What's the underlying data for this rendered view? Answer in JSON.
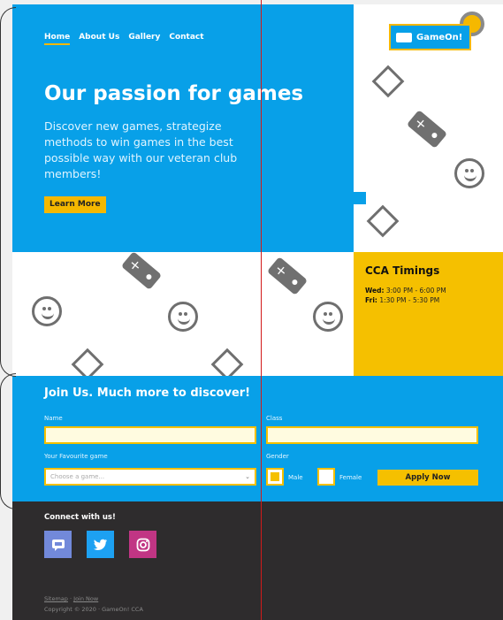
{
  "nav": {
    "items": [
      "Home",
      "About Us",
      "Gallery",
      "Contact"
    ]
  },
  "logo": {
    "text": "GameOn!"
  },
  "hero": {
    "title": "Our passion for games",
    "text": "Discover new games, strategize methods to win games in the best possible way with our veteran club members!",
    "button": "Learn More"
  },
  "timings": {
    "title": "CCA Timings",
    "wed_label": "Wed:",
    "wed_time": "3:00 PM - 6:00 PM",
    "fri_label": "Fri:",
    "fri_time": "1:30 PM - 5:30 PM"
  },
  "join": {
    "title": "Join Us. Much more to discover!",
    "name_label": "Name",
    "class_label": "Class",
    "game_label": "Your Favourite game",
    "game_placeholder": "Choose a game...",
    "gender_label": "Gender",
    "male_label": "Male",
    "female_label": "Female",
    "apply_button": "Apply Now"
  },
  "footer": {
    "connect_title": "Connect with us!",
    "social": [
      {
        "icon": "discord-icon",
        "color": "#7289da"
      },
      {
        "icon": "twitter-icon",
        "color": "#1da1f2"
      },
      {
        "icon": "instagram-icon",
        "color": "#c13584"
      }
    ],
    "link_sitemap": "Sitemap",
    "link_separator": "·",
    "link_join": "Join Now",
    "copyright": "Copyright © 2020 · GameOn! CCA"
  },
  "colors": {
    "blue": "#08a0e8",
    "yellow": "#f5c000",
    "dark": "#2e2c2d"
  }
}
